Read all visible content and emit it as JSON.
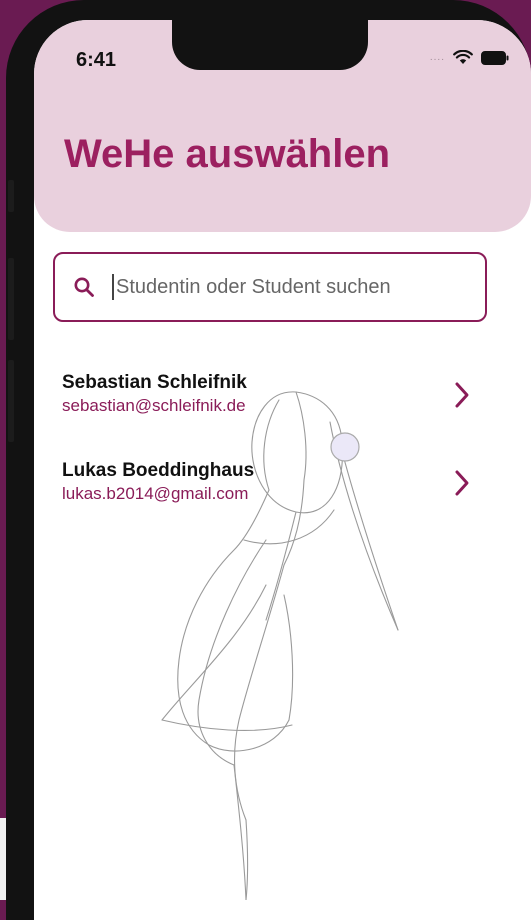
{
  "status_bar": {
    "time": "6:41",
    "signal": "....",
    "icons": [
      "wifi-icon",
      "battery-icon"
    ]
  },
  "header": {
    "title": "WeHe auswählen"
  },
  "search": {
    "placeholder": "Studentin oder Student suchen",
    "value": "",
    "icon": "search-icon"
  },
  "students": [
    {
      "name": "Sebastian Schleifnik",
      "email": "sebastian@schleifnik.de"
    },
    {
      "name": "Lukas Boeddinghaus",
      "email": "lukas.b2014@gmail.com"
    }
  ],
  "colors": {
    "accent": "#9c2060",
    "border": "#8a1c58",
    "header_bg": "#e9d0dd",
    "background": "#6a1b52"
  }
}
